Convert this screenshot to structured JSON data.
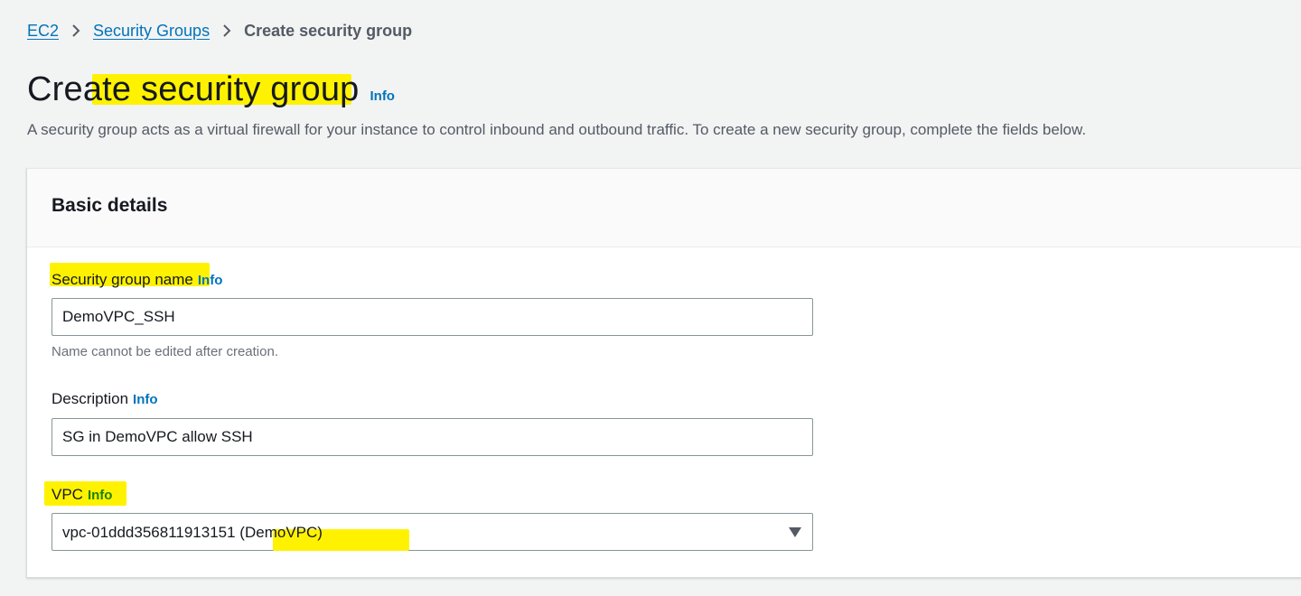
{
  "breadcrumb": {
    "items": [
      {
        "label": "EC2"
      },
      {
        "label": "Security Groups"
      }
    ],
    "current": "Create security group"
  },
  "header": {
    "title": "Create security group",
    "info": "Info",
    "description": "A security group acts as a virtual firewall for your instance to control inbound and outbound traffic. To create a new security group, complete the fields below."
  },
  "basic_details": {
    "title": "Basic details",
    "name_field": {
      "label": "Security group name",
      "info": "Info",
      "value": "DemoVPC_SSH",
      "hint": "Name cannot be edited after creation."
    },
    "description_field": {
      "label": "Description",
      "info": "Info",
      "value": "SG in DemoVPC allow SSH"
    },
    "vpc_field": {
      "label": "VPC",
      "info": "Info",
      "value_id": "vpc-01ddd356811913151 (",
      "value_name": "DemoVPC)"
    }
  },
  "colors": {
    "link": "#0073bb",
    "highlight": "#fff200",
    "background": "#f2f3f3"
  },
  "icons": {
    "breadcrumb_separator": "chevron-right-icon",
    "select_caret": "caret-down-icon"
  }
}
